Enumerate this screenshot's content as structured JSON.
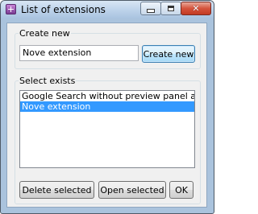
{
  "window": {
    "title": "List of extensions",
    "minimize_symbol": "",
    "maximize_symbol": "",
    "close_symbol": "✕"
  },
  "create_group": {
    "label": "Create new",
    "name_value": "Nove extension",
    "create_button": "Create new"
  },
  "select_group": {
    "label": "Select exists",
    "items": [
      {
        "label": "Google Search without preview panel and with dire",
        "selected": false
      },
      {
        "label": "Nove extension",
        "selected": true
      }
    ]
  },
  "buttons": {
    "delete": "Delete selected",
    "open": "Open selected",
    "ok": "OK"
  },
  "colors": {
    "selection": "#3399ff",
    "frame": "#aac3dd",
    "close_button": "#d5533c"
  }
}
